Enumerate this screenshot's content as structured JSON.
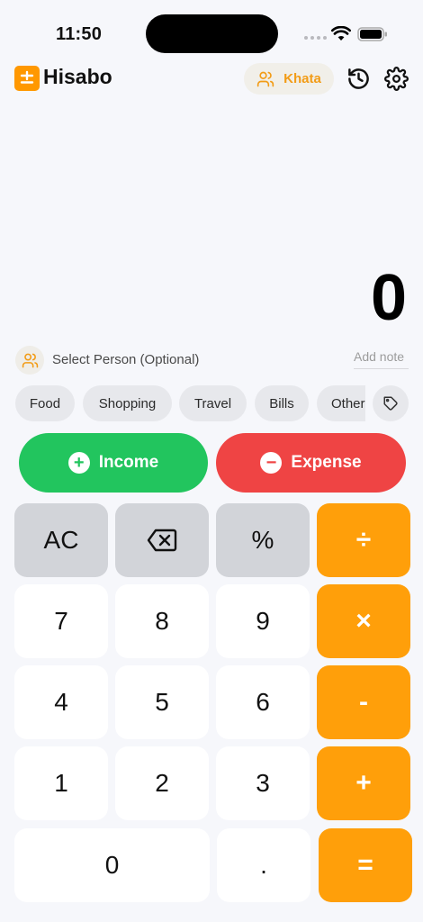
{
  "status_bar": {
    "time": "11:50"
  },
  "header": {
    "title": "Hisabo",
    "khata_label": "Khata"
  },
  "display": {
    "value": "0"
  },
  "person": {
    "label": "Select Person (Optional)"
  },
  "note": {
    "placeholder": "Add note"
  },
  "categories": [
    "Food",
    "Shopping",
    "Travel",
    "Bills",
    "Other"
  ],
  "type_buttons": {
    "income": "Income",
    "expense": "Expense"
  },
  "keypad": {
    "ac": "AC",
    "percent": "%",
    "divide": "÷",
    "k7": "7",
    "k8": "8",
    "k9": "9",
    "multiply": "×",
    "k4": "4",
    "k5": "5",
    "k6": "6",
    "minus": "-",
    "k1": "1",
    "k2": "2",
    "k3": "3",
    "plus": "+",
    "k0": "0",
    "dot": ".",
    "equals": "="
  },
  "icons": {
    "logo": "plus-minus-icon",
    "khata": "users-icon",
    "history": "history-icon",
    "settings": "gear-icon",
    "person": "users-icon",
    "tag": "tag-icon",
    "backspace": "backspace-icon"
  },
  "colors": {
    "accent": "#ff9f0a",
    "income": "#22c55e",
    "expense": "#ef4444",
    "function_key": "#d2d4d9",
    "background": "#f6f7fb"
  }
}
